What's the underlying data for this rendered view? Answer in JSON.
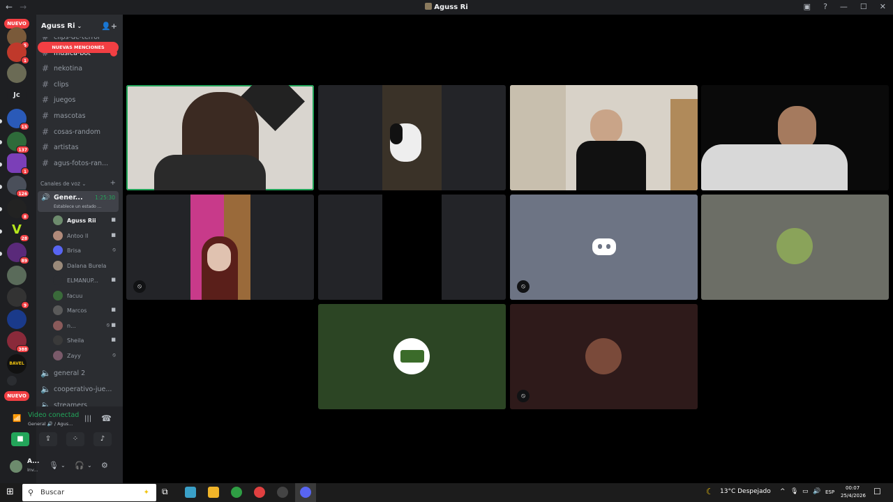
{
  "window": {
    "title": "Aguss Ri",
    "back": "←",
    "forward": "→"
  },
  "server_rail": {
    "nuevo_top": "NUEVO",
    "nuevo_bottom": "NUEVO",
    "jc_label": "Jc",
    "bavel_label": "BAVEL",
    "badges": [
      "5",
      "1",
      "15",
      "137",
      "1",
      "126",
      "8",
      "28",
      "89",
      "9",
      "388"
    ]
  },
  "guild": {
    "name": "Aguss Ri",
    "mentions_banner": "NUEVAS MENCIONES"
  },
  "text_channels": [
    "clips-de-terror",
    "musica-bot",
    "nekotina",
    "clips",
    "juegos",
    "mascotas",
    "cosas-random",
    "artistas",
    "agus-fotos-ran..."
  ],
  "voice_section": {
    "label": "Canales de voz"
  },
  "voice_active": {
    "name": "Gener...",
    "timer": "1:25:30",
    "status": "Establece un estado ..."
  },
  "voice_users": [
    "Aguss Rii",
    "Antoo ll",
    "Brisa",
    "Dalana Burela",
    "ELMANUP...",
    "facuu",
    "Marcos",
    "n...",
    "Sheila",
    "Zayy"
  ],
  "other_voice_channels": [
    "general 2",
    "cooperativo-jue...",
    "streamers"
  ],
  "voice_panel": {
    "status": "Video conectad",
    "location": "General 🔊 / Agus..."
  },
  "user": {
    "name": "A...",
    "status": "Inv..."
  },
  "taskbar": {
    "search_placeholder": "Buscar",
    "weather": "13°C  Despejado",
    "lang": "ESP",
    "time": "00:07",
    "date": "25/4/2026"
  },
  "colors": {
    "accent_green": "#23a55a",
    "badge_red": "#f23f43",
    "blurple": "#5865f2"
  }
}
